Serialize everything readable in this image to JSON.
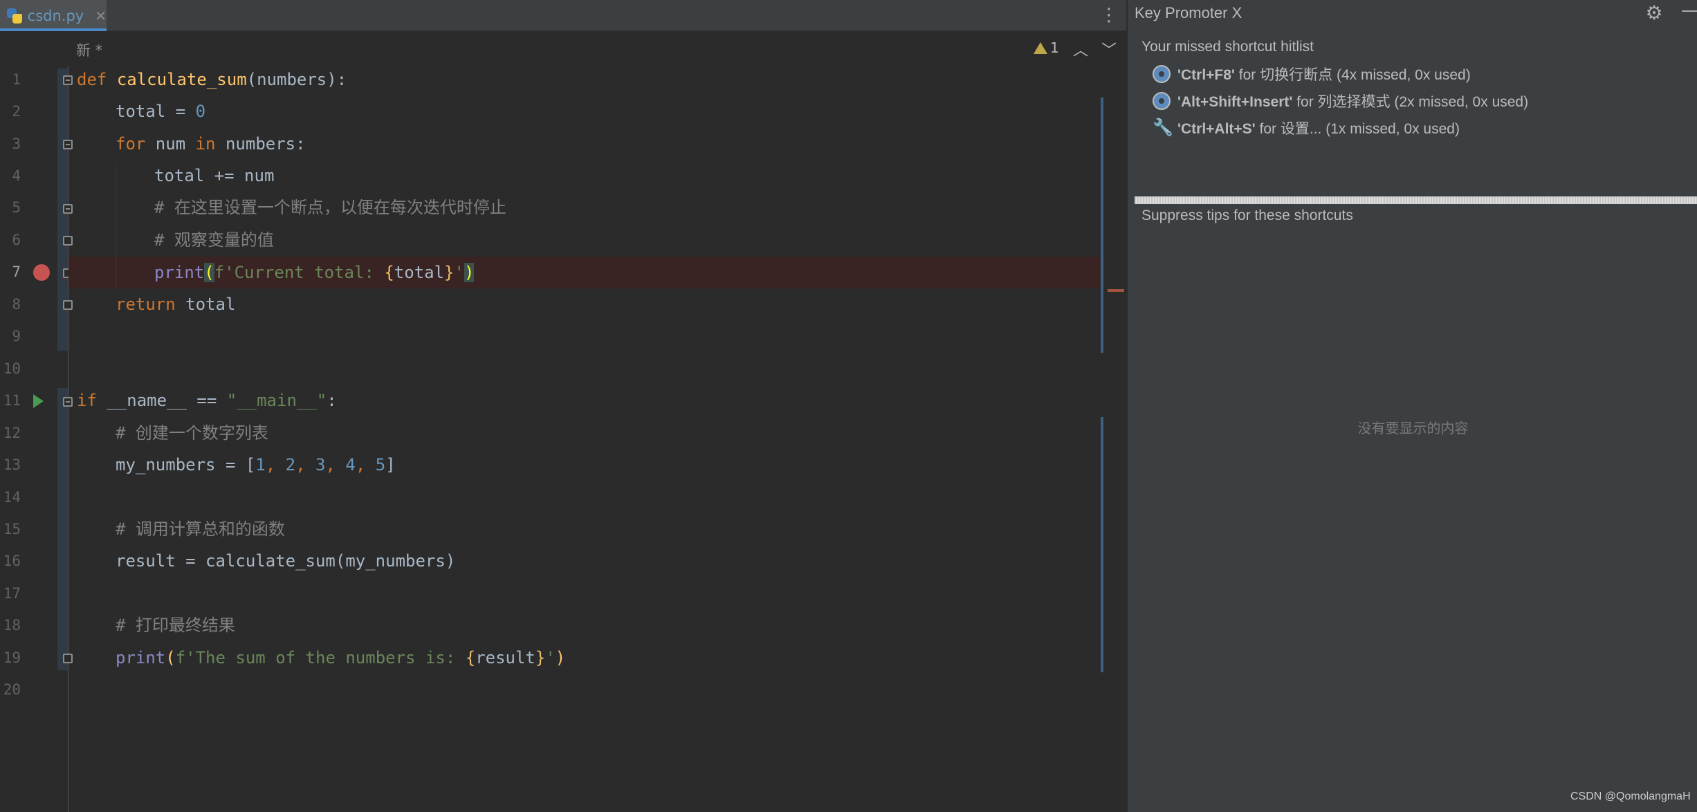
{
  "tab": {
    "filename": "csdn.py",
    "close_glyph": "✕"
  },
  "toolbar": {
    "more_glyph": "⋮"
  },
  "breadcrumb": {
    "text": "新 *"
  },
  "inspections": {
    "warning_count": "1",
    "prev_glyph": "︿",
    "next_glyph": "﹀"
  },
  "line_numbers": [
    "1",
    "2",
    "3",
    "4",
    "5",
    "6",
    "7",
    "8",
    "9",
    "10",
    "11",
    "12",
    "13",
    "14",
    "15",
    "16",
    "17",
    "18",
    "19",
    "20"
  ],
  "code": {
    "l1": {
      "kw": "def",
      "name": "calculate_sum",
      "rest": "(numbers):"
    },
    "l2": {
      "a": "total = ",
      "num": "0"
    },
    "l3": {
      "kw": "for",
      "a": " num ",
      "kw2": "in",
      "b": " numbers:"
    },
    "l4": {
      "a": "total += num"
    },
    "l5": {
      "cmt": "# 在这里设置一个断点，以便在每次迭代时停止"
    },
    "l6": {
      "cmt": "# 观察变量的值"
    },
    "l7": {
      "bi": "print",
      "p1": "(",
      "s1": "f'Current total: ",
      "b1": "{",
      "v": "total",
      "b2": "}",
      "s2": "'",
      "p2": ")"
    },
    "l8": {
      "kw": "return",
      "a": " total"
    },
    "l11": {
      "kw": "if",
      "a": " __name__ == ",
      "str": "\"__main__\"",
      "b": ":"
    },
    "l12": {
      "cmt": "# 创建一个数字列表"
    },
    "l13": {
      "a": "my_numbers = [",
      "n1": "1",
      "c1": ", ",
      "n2": "2",
      "c2": ", ",
      "n3": "3",
      "c3": ", ",
      "n4": "4",
      "c4": ", ",
      "n5": "5",
      "b": "]"
    },
    "l15": {
      "cmt": "# 调用计算总和的函数"
    },
    "l16": {
      "a": "result = calculate_sum(my_numbers)"
    },
    "l18": {
      "cmt": "# 打印最终结果"
    },
    "l19": {
      "bi": "print",
      "p1": "(",
      "s1": "f'The sum of the numbers is: ",
      "b1": "{",
      "v": "result",
      "b2": "}",
      "s2": "'",
      "p2": ")"
    }
  },
  "panel": {
    "title": "Key Promoter X",
    "gear_glyph": "⚙",
    "minimize_glyph": "—",
    "hitlist_title": "Your missed shortcut hitlist",
    "hits": [
      {
        "shortcut": "'Ctrl+F8'",
        "text": " for 切换行断点 (4x missed, 0x used)",
        "icon": "debug-icon"
      },
      {
        "shortcut": "'Alt+Shift+Insert'",
        "text": " for 列选择模式 (2x missed, 0x used)",
        "icon": "debug-icon"
      },
      {
        "shortcut": "'Ctrl+Alt+S'",
        "text": " for 设置... (1x missed, 0x used)",
        "icon": "wrench-icon"
      }
    ],
    "wrench_glyph": "🔧",
    "suppress_title": "Suppress tips for these shortcuts",
    "empty_text": "没有要显示的内容",
    "watermark": "CSDN @QomolangmaH"
  },
  "colors": {
    "keyword": "#cc7832",
    "function": "#ffc66d",
    "number": "#6897bb",
    "string": "#6a8759",
    "comment": "#808080",
    "builtin": "#8888c6",
    "breakpoint": "#c75450"
  }
}
